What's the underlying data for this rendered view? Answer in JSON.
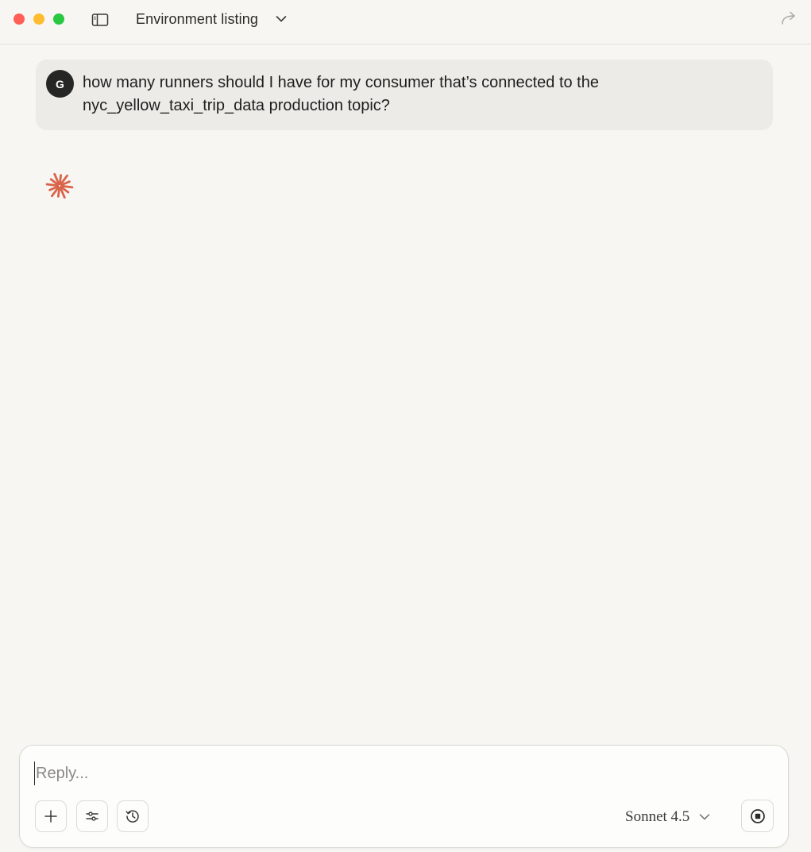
{
  "window": {
    "title": "Environment listing"
  },
  "icons": {
    "sidebar_toggle": "sidebar-icon",
    "title_chevron": "chevron-down-icon",
    "share": "share-icon",
    "assistant_mark": "spark-icon",
    "add": "plus-icon",
    "settings": "sliders-icon",
    "history": "clock-icon",
    "model_chevron": "chevron-down-icon",
    "stop": "stop-icon"
  },
  "conversation": {
    "user_message": {
      "avatar_initial": "G",
      "text": "how many runners should I have for my consumer that’s connected to the nyc_yellow_taxi_trip_data production topic?"
    }
  },
  "composer": {
    "placeholder": "Reply...",
    "value": "",
    "model_label": "Sonnet 4.5"
  },
  "colors": {
    "background": "#f7f6f3",
    "user_bubble": "#ecebe7",
    "avatar": "#262624",
    "accent": "#d9644a",
    "traffic_red": "#ff5f57",
    "traffic_yellow": "#febc2e",
    "traffic_green": "#28c840"
  }
}
